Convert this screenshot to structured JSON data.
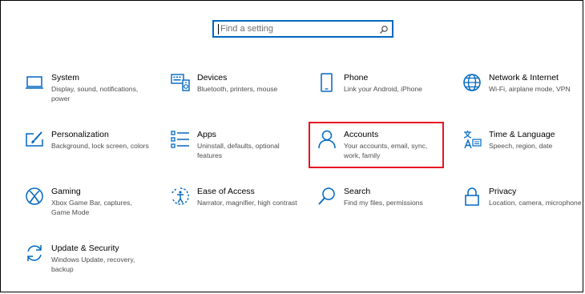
{
  "search": {
    "placeholder": "Find a setting",
    "value": ""
  },
  "colors": {
    "accent": "#0067c0",
    "highlight": "#e81123"
  },
  "tiles": [
    {
      "id": "system",
      "title": "System",
      "desc": "Display, sound, notifications, power",
      "icon": "laptop-icon"
    },
    {
      "id": "devices",
      "title": "Devices",
      "desc": "Bluetooth, printers, mouse",
      "icon": "devices-icon"
    },
    {
      "id": "phone",
      "title": "Phone",
      "desc": "Link your Android, iPhone",
      "icon": "phone-icon"
    },
    {
      "id": "network",
      "title": "Network & Internet",
      "desc": "Wi-Fi, airplane mode, VPN",
      "icon": "globe-icon"
    },
    {
      "id": "personalization",
      "title": "Personalization",
      "desc": "Background, lock screen, colors",
      "icon": "paintbrush-icon"
    },
    {
      "id": "apps",
      "title": "Apps",
      "desc": "Uninstall, defaults, optional features",
      "icon": "apps-list-icon"
    },
    {
      "id": "accounts",
      "title": "Accounts",
      "desc": "Your accounts, email, sync, work, family",
      "icon": "person-icon"
    },
    {
      "id": "time-language",
      "title": "Time & Language",
      "desc": "Speech, region, date",
      "icon": "language-icon"
    },
    {
      "id": "gaming",
      "title": "Gaming",
      "desc": "Xbox Game Bar, captures, Game Mode",
      "icon": "xbox-icon"
    },
    {
      "id": "ease-of-access",
      "title": "Ease of Access",
      "desc": "Narrator, magnifier, high contrast",
      "icon": "ease-of-access-icon"
    },
    {
      "id": "search",
      "title": "Search",
      "desc": "Find my files, permissions",
      "icon": "magnifier-icon"
    },
    {
      "id": "privacy",
      "title": "Privacy",
      "desc": "Location, camera, microphone",
      "icon": "lock-icon"
    },
    {
      "id": "update-security",
      "title": "Update & Security",
      "desc": "Windows Update, recovery, backup",
      "icon": "sync-arrows-icon"
    }
  ]
}
